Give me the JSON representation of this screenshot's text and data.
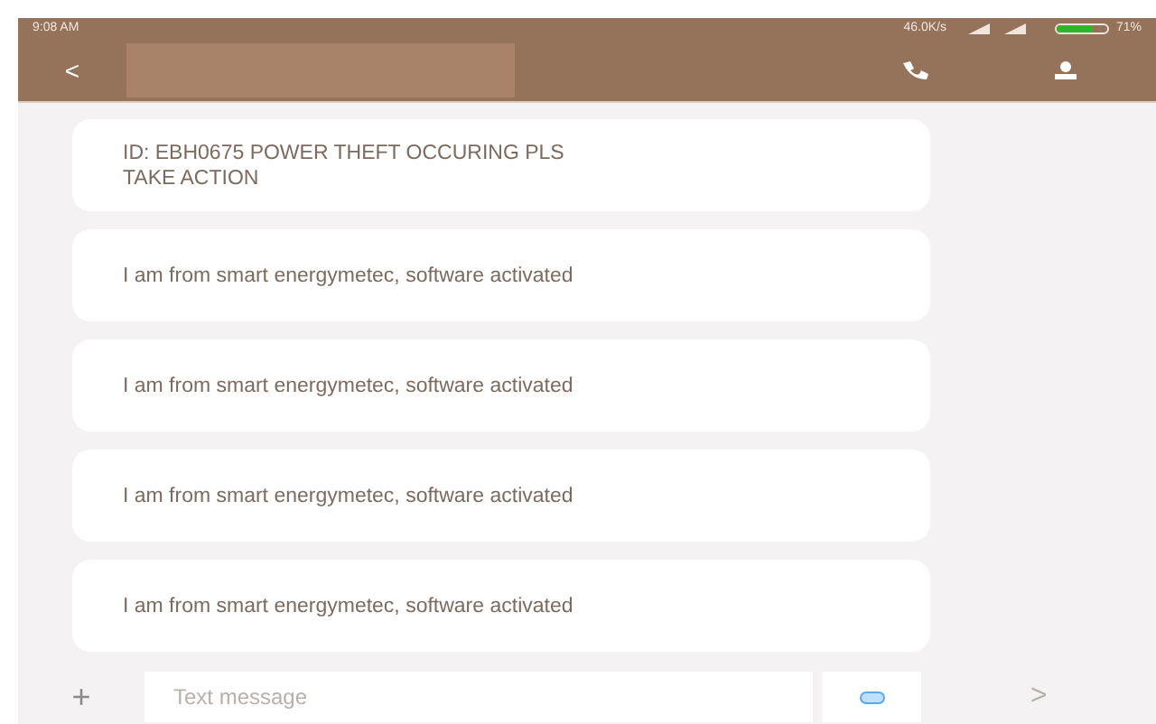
{
  "status_bar": {
    "time": "9:08 AM",
    "network_speed": "46.0K/s",
    "battery": "71%"
  },
  "header": {
    "back": "<"
  },
  "messages": [
    {
      "text": "ID: EBH0675 POWER THEFT OCCURING PLS TAKE ACTION"
    },
    {
      "text": "I am from smart energymetec, software activated"
    },
    {
      "text": "I am from smart energymetec, software activated"
    },
    {
      "text": "I am from smart energymetec, software activated"
    },
    {
      "text": "I am from smart energymetec, software activated"
    }
  ],
  "composer": {
    "add": "+",
    "placeholder": "Text message",
    "send": ">"
  }
}
